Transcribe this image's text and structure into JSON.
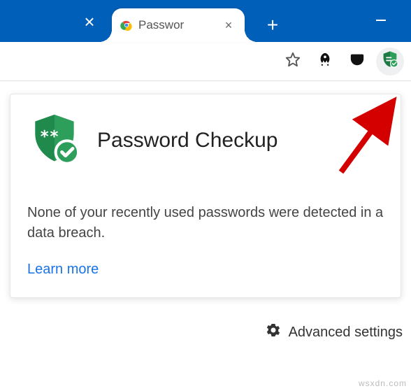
{
  "titlebar": {
    "active_tab_title": "Passwor",
    "close_glyph": "×",
    "plus_glyph": "+"
  },
  "toolbar": {
    "star_title": "Bookmark",
    "rocket_title": "Rocket extension",
    "pocket_title": "Pocket",
    "ext_title": "Password Checkup"
  },
  "popup": {
    "title": "Password Checkup",
    "body": "None of your recently used passwords were detected in a data breach.",
    "learn_more": "Learn more",
    "advanced": "Advanced settings"
  },
  "watermark": "wsxdn.com"
}
